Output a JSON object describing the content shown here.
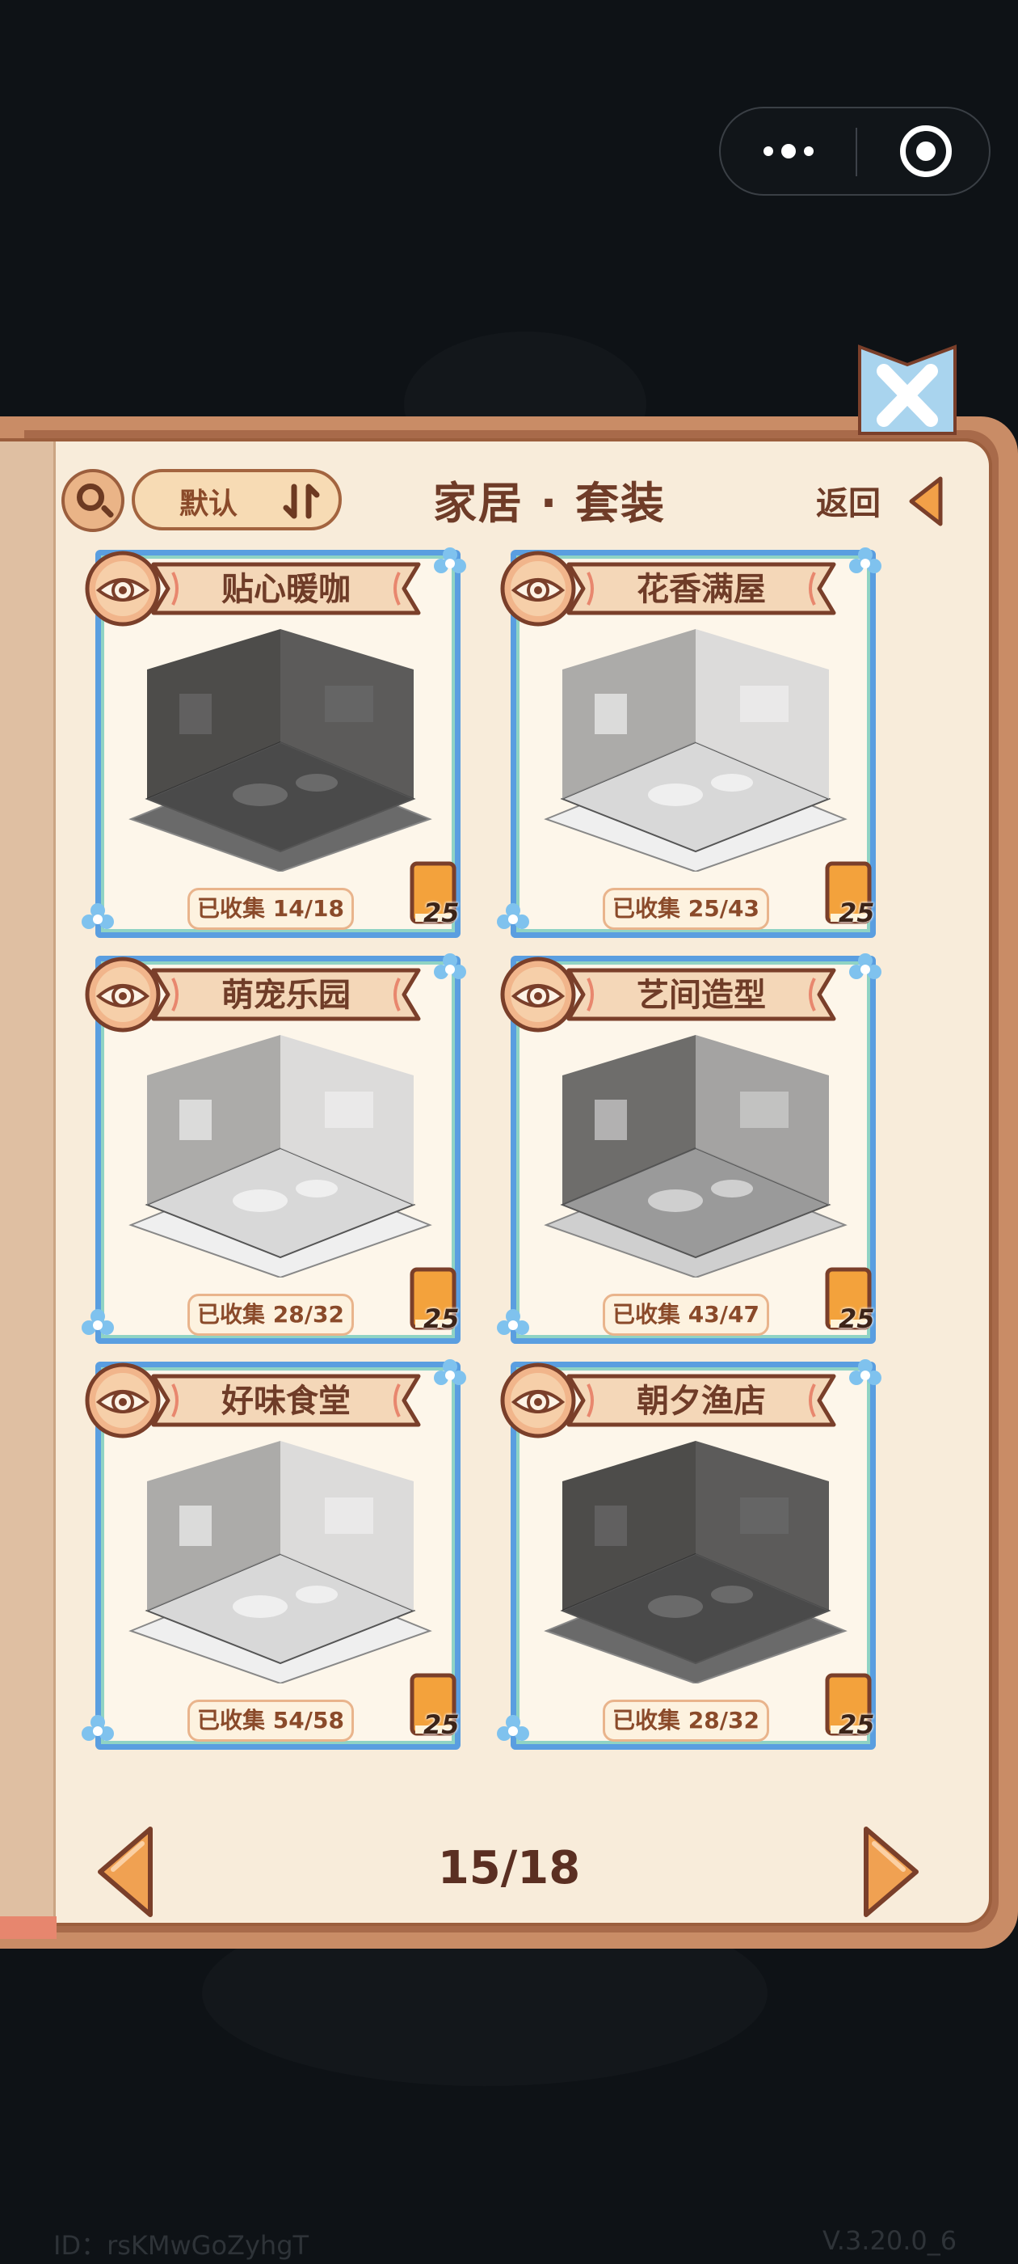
{
  "header": {
    "sort_label": "默认",
    "title": "家居 · 套装",
    "back_label": "返回"
  },
  "cards": [
    {
      "title": "贴心暖咖",
      "collected": "已收集 14/18",
      "book_count": "25",
      "room_tone": "dark"
    },
    {
      "title": "花香满屋",
      "collected": "已收集 25/43",
      "book_count": "25",
      "room_tone": "light"
    },
    {
      "title": "萌宠乐园",
      "collected": "已收集 28/32",
      "book_count": "25",
      "room_tone": "light"
    },
    {
      "title": "艺间造型",
      "collected": "已收集 43/47",
      "book_count": "25",
      "room_tone": "medium"
    },
    {
      "title": "好味食堂",
      "collected": "已收集 54/58",
      "book_count": "25",
      "room_tone": "light"
    },
    {
      "title": "朝夕渔店",
      "collected": "已收集 28/32",
      "book_count": "25",
      "room_tone": "dark"
    }
  ],
  "pager": {
    "text": "15/18"
  },
  "footer": {
    "id": "ID：rsKMwGoZyhgT",
    "version": "V.3.20.0_6"
  },
  "colors": {
    "frame_blue": "#5a9ee0",
    "frame_inner": "#8fd3c4",
    "ribbon": "#f4d7b8",
    "ribbon_border": "#7a3f2a",
    "title_brown": "#6f3c28",
    "page_bg": "#f8ecda",
    "book_orange": "#f3a23c"
  }
}
